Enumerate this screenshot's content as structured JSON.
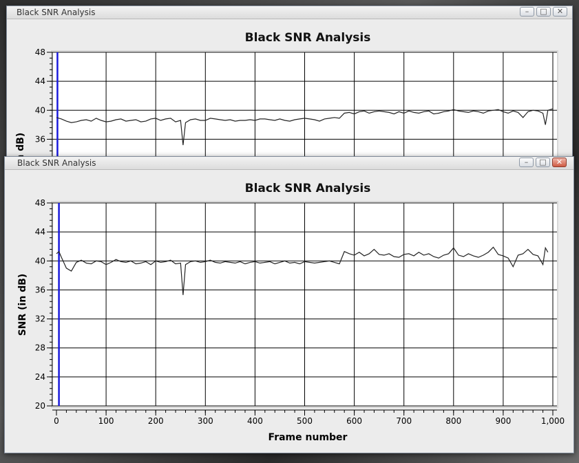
{
  "windows": [
    {
      "title": "Black SNR Analysis",
      "buttons": {
        "minimize": "–",
        "maximize": "□",
        "close": "✕"
      },
      "chart_data": {
        "type": "line",
        "title": "Black SNR Analysis",
        "xlabel": "",
        "ylabel": "SNR (in dB)",
        "xlim": [
          0,
          1000
        ],
        "ylim": [
          20,
          48
        ],
        "visible_ylim": [
          34,
          48
        ],
        "xticks": [],
        "yticks": [
          48,
          44,
          40,
          36
        ],
        "grid": true,
        "marker_x": 2,
        "series": [
          {
            "x": [
              0,
              10,
              20,
              30,
              40,
              50,
              60,
              70,
              80,
              90,
              100,
              110,
              120,
              130,
              140,
              150,
              160,
              170,
              180,
              190,
              200,
              210,
              220,
              230,
              240,
              250,
              255,
              260,
              270,
              280,
              290,
              300,
              310,
              320,
              330,
              340,
              350,
              360,
              370,
              380,
              390,
              400,
              410,
              420,
              430,
              440,
              450,
              460,
              470,
              480,
              490,
              500,
              510,
              520,
              530,
              540,
              550,
              560,
              570,
              580,
              590,
              600,
              610,
              620,
              630,
              640,
              650,
              660,
              670,
              680,
              690,
              700,
              710,
              720,
              730,
              740,
              750,
              760,
              770,
              780,
              790,
              800,
              810,
              820,
              830,
              840,
              850,
              860,
              870,
              880,
              890,
              900,
              910,
              920,
              930,
              940,
              950,
              960,
              970,
              980,
              985,
              990,
              1000
            ],
            "y": [
              39.0,
              38.8,
              38.5,
              38.3,
              38.4,
              38.6,
              38.7,
              38.5,
              38.9,
              38.6,
              38.4,
              38.5,
              38.7,
              38.8,
              38.5,
              38.6,
              38.7,
              38.4,
              38.5,
              38.8,
              38.9,
              38.6,
              38.8,
              38.9,
              38.4,
              38.6,
              35.2,
              38.3,
              38.7,
              38.8,
              38.6,
              38.6,
              38.9,
              38.8,
              38.7,
              38.6,
              38.7,
              38.5,
              38.6,
              38.6,
              38.7,
              38.6,
              38.8,
              38.8,
              38.7,
              38.6,
              38.8,
              38.6,
              38.5,
              38.7,
              38.8,
              38.9,
              38.8,
              38.7,
              38.5,
              38.8,
              38.9,
              39.0,
              38.9,
              39.6,
              39.7,
              39.5,
              39.8,
              39.9,
              39.6,
              39.8,
              39.9,
              39.8,
              39.7,
              39.5,
              39.8,
              39.6,
              39.9,
              39.7,
              39.6,
              39.8,
              39.9,
              39.5,
              39.6,
              39.8,
              39.9,
              40.1,
              39.9,
              39.8,
              39.7,
              39.9,
              39.8,
              39.6,
              39.9,
              40.0,
              40.1,
              39.8,
              39.6,
              39.9,
              39.7,
              39.0,
              39.8,
              40.0,
              39.9,
              39.6,
              38.0,
              40.0,
              40.2
            ]
          }
        ]
      }
    },
    {
      "title": "Black SNR Analysis",
      "buttons": {
        "minimize": "–",
        "maximize": "□",
        "close": "✕"
      },
      "chart_data": {
        "type": "line",
        "title": "Black SNR Analysis",
        "xlabel": "Frame number",
        "ylabel": "SNR (in dB)",
        "xlim": [
          0,
          1000
        ],
        "ylim": [
          20,
          48
        ],
        "xticks": [
          0,
          100,
          200,
          300,
          400,
          500,
          600,
          700,
          800,
          900,
          1000
        ],
        "xtick_labels": [
          "0",
          "100",
          "200",
          "300",
          "400",
          "500",
          "600",
          "700",
          "800",
          "900",
          "1,000"
        ],
        "yticks": [
          48,
          44,
          40,
          36,
          32,
          28,
          24,
          20
        ],
        "grid": true,
        "marker_x": 5,
        "series": [
          {
            "x": [
              0,
              5,
              10,
              20,
              30,
              40,
              50,
              60,
              70,
              80,
              90,
              100,
              110,
              120,
              130,
              140,
              150,
              160,
              170,
              180,
              190,
              200,
              210,
              220,
              230,
              240,
              250,
              255,
              260,
              270,
              280,
              290,
              300,
              310,
              320,
              330,
              340,
              350,
              360,
              370,
              380,
              390,
              400,
              410,
              420,
              430,
              440,
              450,
              460,
              470,
              480,
              490,
              500,
              510,
              520,
              530,
              540,
              550,
              560,
              570,
              580,
              590,
              600,
              610,
              620,
              630,
              640,
              650,
              660,
              670,
              680,
              690,
              700,
              710,
              720,
              730,
              740,
              750,
              760,
              770,
              780,
              790,
              800,
              810,
              820,
              830,
              840,
              850,
              860,
              870,
              880,
              890,
              900,
              910,
              920,
              930,
              940,
              950,
              960,
              970,
              980,
              985,
              990,
              1000
            ],
            "y": [
              41.0,
              41.3,
              40.5,
              39.0,
              38.6,
              39.8,
              40.1,
              39.7,
              39.6,
              40.0,
              39.9,
              39.5,
              39.8,
              40.2,
              39.9,
              39.8,
              40.0,
              39.6,
              39.7,
              39.9,
              39.5,
              40.0,
              39.8,
              39.9,
              40.1,
              39.6,
              39.7,
              35.3,
              39.5,
              39.9,
              40.0,
              39.8,
              39.9,
              40.1,
              39.8,
              39.7,
              39.9,
              39.8,
              39.7,
              39.9,
              39.6,
              39.8,
              39.9,
              39.7,
              39.8,
              39.9,
              39.6,
              39.8,
              40.0,
              39.7,
              39.8,
              39.6,
              39.9,
              39.8,
              39.7,
              39.8,
              39.9,
              40.0,
              39.8,
              39.6,
              41.3,
              41.0,
              40.8,
              41.2,
              40.7,
              41.0,
              41.6,
              40.9,
              40.8,
              41.0,
              40.6,
              40.5,
              40.9,
              41.0,
              40.7,
              41.2,
              40.8,
              41.0,
              40.6,
              40.4,
              40.8,
              41.0,
              41.8,
              40.8,
              40.6,
              41.0,
              40.7,
              40.5,
              40.8,
              41.2,
              41.9,
              40.9,
              40.7,
              40.4,
              39.2,
              40.8,
              41.0,
              41.6,
              40.9,
              40.7,
              39.5,
              41.8,
              41.2
            ]
          }
        ]
      }
    }
  ],
  "colors": {
    "line": "#222222",
    "marker": "#1a1adc",
    "grid": "#000000",
    "plot_bg": "#ffffff",
    "frame_bg": "#ececec"
  }
}
